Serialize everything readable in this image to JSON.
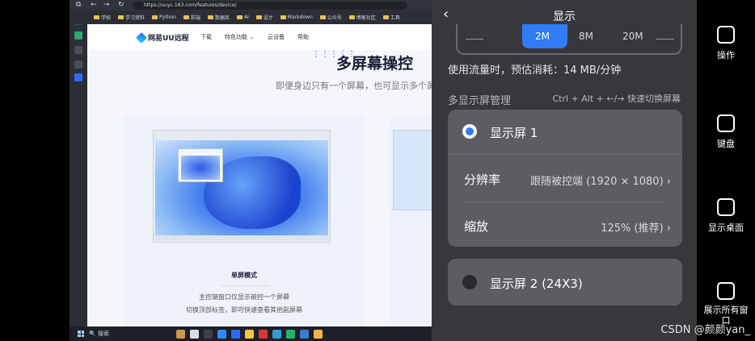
{
  "browser": {
    "url": "https://uuyc.163.com/features/device/",
    "bookmarks": [
      "学校",
      "学习资料",
      "Python",
      "前端",
      "数据库",
      "AI",
      "设计",
      "Markdown",
      "公众号",
      "博客社区",
      "工具"
    ]
  },
  "site": {
    "logo": "网易UU远程",
    "nav": [
      "下载",
      "特色功能 ⌄",
      "云设备",
      "帮助"
    ],
    "hero_title": "多屏幕操控",
    "hero_subtitle": "即便身边只有一个屏幕，也可显示多个屏幕内容",
    "card": {
      "title": "单屏模式",
      "desc1": "主控端窗口仅显示被控一个屏幕",
      "desc2": "切换顶部标签，即可快速查看其他副屏幕"
    }
  },
  "taskbar": {
    "search": "搜索"
  },
  "panel": {
    "title": "显示",
    "quality_options": [
      "2M",
      "8M",
      "20M"
    ],
    "quality_selected": "2M",
    "traffic": "使用流量时，预估消耗：14 MB/分钟",
    "manage_label": "多显示屏管理",
    "shortcut": "Ctrl + Alt + ←/→ 快速切换屏幕",
    "display1": {
      "label": "显示屏 1",
      "resolution_label": "分辨率",
      "resolution_value": "跟随被控端 (1920 × 1080)",
      "zoom_label": "缩放",
      "zoom_value": "125% (推荐)",
      "selected": true
    },
    "display2": {
      "label": "显示屏 2 (24X3)",
      "selected": false
    },
    "accent": "#2f7cf6"
  },
  "toolbar": {
    "items": [
      {
        "label": "操作",
        "icon": "toggle-icon"
      },
      {
        "label": "键盘",
        "icon": "keyboard-icon"
      },
      {
        "label": "显示桌面",
        "icon": "desktop-icon"
      },
      {
        "label": "展示所有窗口",
        "icon": "windows-grid-icon"
      }
    ]
  },
  "watermark": "CSDN @颜颜yan_"
}
